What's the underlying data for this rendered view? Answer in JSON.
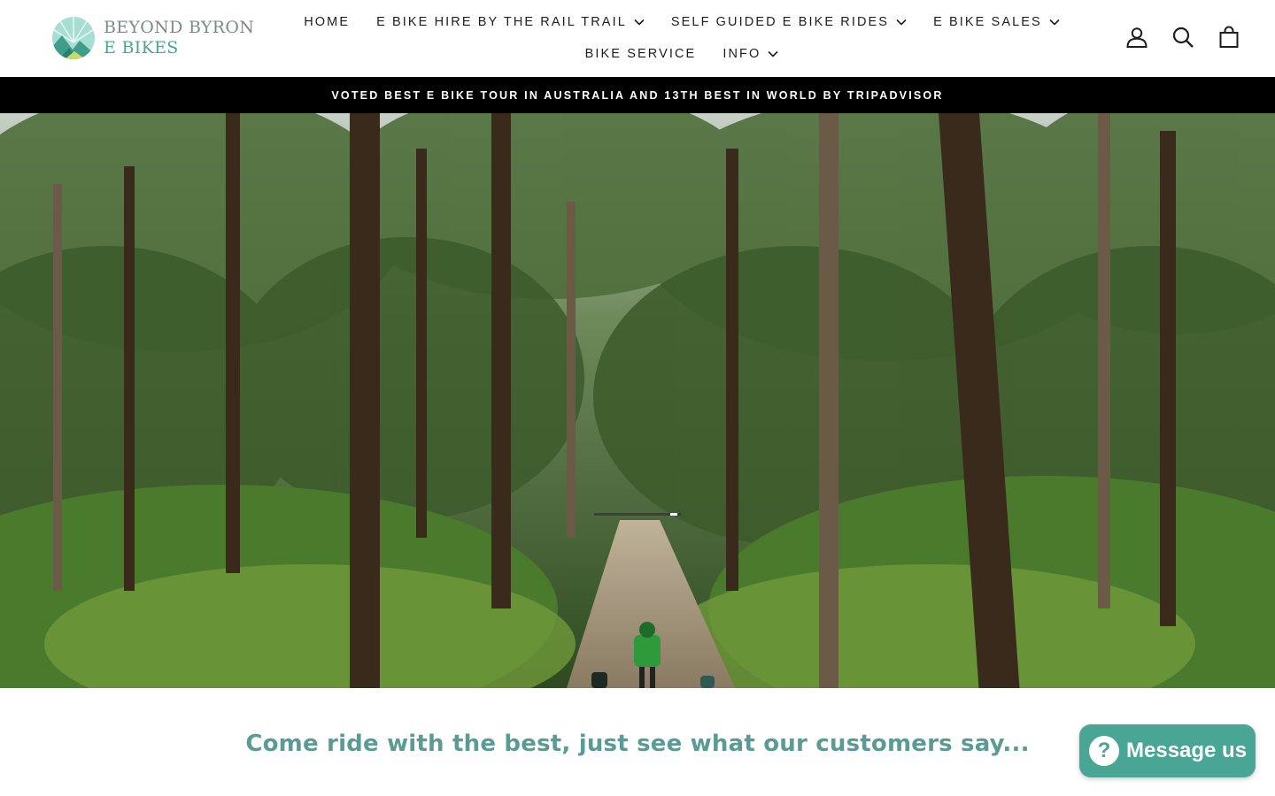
{
  "brand": {
    "line1": "BEYOND BYRON",
    "line2": "E BIKES",
    "colors": {
      "teal": "#4aa595",
      "grey": "#7d8a89",
      "mint": "#a7ddd3"
    }
  },
  "nav": {
    "row1": [
      {
        "label": "HOME",
        "has_dropdown": false
      },
      {
        "label": "E BIKE HIRE BY THE RAIL TRAIL",
        "has_dropdown": true
      },
      {
        "label": "SELF GUIDED E BIKE RIDES",
        "has_dropdown": true
      },
      {
        "label": "E BIKE SALES",
        "has_dropdown": true
      }
    ],
    "row2": [
      {
        "label": "BIKE SERVICE",
        "has_dropdown": false
      },
      {
        "label": "INFO",
        "has_dropdown": true
      }
    ]
  },
  "header_icons": [
    "account-icon",
    "search-icon",
    "cart-icon"
  ],
  "announcement": {
    "text": "VOTED BEST E BIKE TOUR IN AUSTRALIA AND 13TH BEST IN WORLD BY TRIPADVISOR",
    "background": "#000000"
  },
  "hero": {
    "video_progress": 0.92
  },
  "tagline": "Come ride with the best, just see what our customers say...",
  "chat": {
    "label": "Message us",
    "icon_glyph": "?",
    "color": "#49a594"
  }
}
